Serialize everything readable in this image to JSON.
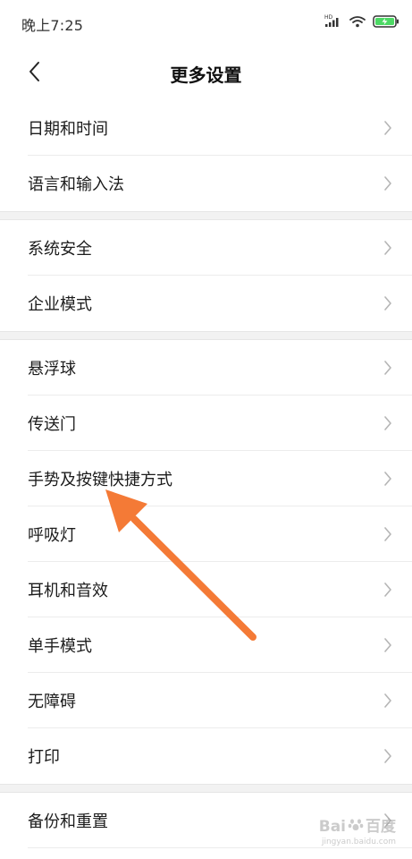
{
  "status_bar": {
    "time": "晚上7:25",
    "network_label": "HD",
    "battery_color": "#4cd964"
  },
  "header": {
    "title": "更多设置",
    "back_icon": "chevron-left-icon"
  },
  "groups": [
    {
      "items": [
        {
          "label": "日期和时间"
        },
        {
          "label": "语言和输入法"
        }
      ]
    },
    {
      "items": [
        {
          "label": "系统安全"
        },
        {
          "label": "企业模式"
        }
      ]
    },
    {
      "items": [
        {
          "label": "悬浮球"
        },
        {
          "label": "传送门"
        },
        {
          "label": "手势及按键快捷方式"
        },
        {
          "label": "呼吸灯"
        },
        {
          "label": "耳机和音效"
        },
        {
          "label": "单手模式"
        },
        {
          "label": "无障碍"
        },
        {
          "label": "打印"
        }
      ]
    },
    {
      "items": [
        {
          "label": "备份和重置"
        }
      ]
    }
  ],
  "annotation": {
    "arrow_color": "#f47a36",
    "points_to": "手势及按键快捷方式"
  },
  "watermark": {
    "main_text": "Bai",
    "main_text_suffix": "百度",
    "sub_text": "jingyan.baidu.com"
  }
}
